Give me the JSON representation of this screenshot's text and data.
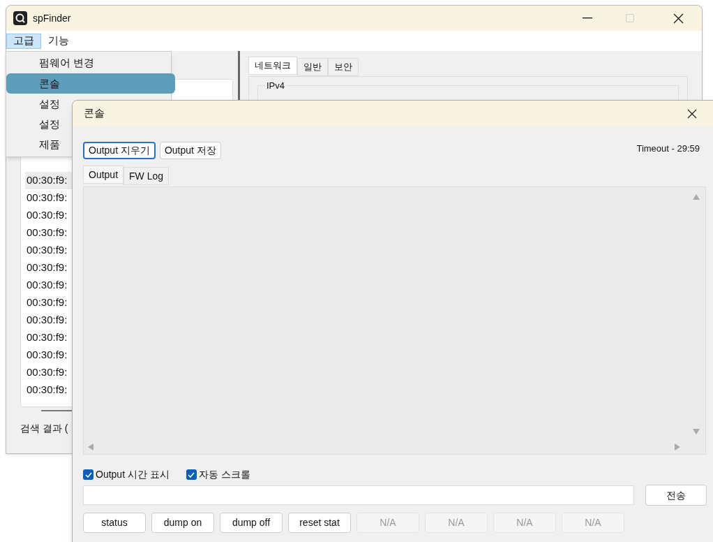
{
  "main_window": {
    "title": "spFinder",
    "menu_bar": [
      {
        "label": "고급",
        "selected": true
      },
      {
        "label": "기능",
        "selected": false
      }
    ],
    "tabs": [
      {
        "label": "네트워크",
        "selected": true
      },
      {
        "label": "일반",
        "selected": false
      },
      {
        "label": "보안",
        "selected": false
      }
    ],
    "group_title": "IPv4",
    "device_list": [
      {
        "label": "00:30:f9:",
        "selected": true
      },
      {
        "label": "00:30:f9:",
        "selected": false
      },
      {
        "label": "00:30:f9:",
        "selected": false
      },
      {
        "label": "00:30:f9:",
        "selected": false
      },
      {
        "label": "00:30:f9:",
        "selected": false
      },
      {
        "label": "00:30:f9:",
        "selected": false
      },
      {
        "label": "00:30:f9:",
        "selected": false
      },
      {
        "label": "00:30:f9:",
        "selected": false
      },
      {
        "label": "00:30:f9:",
        "selected": false
      },
      {
        "label": "00:30:f9:",
        "selected": false
      },
      {
        "label": "00:30:f9:",
        "selected": false
      },
      {
        "label": "00:30:f9:",
        "selected": false
      },
      {
        "label": "00:30:f9:",
        "selected": false
      }
    ],
    "status_text": "검색 결과 ("
  },
  "menu_dropdown": [
    {
      "label": "펌웨어 변경",
      "selected": false
    },
    {
      "label": "콘솔",
      "selected": true
    },
    {
      "label": "설정",
      "selected": false
    },
    {
      "label": "설정",
      "selected": false
    },
    {
      "label": "제품",
      "selected": false
    }
  ],
  "console": {
    "title": "콘솔",
    "buttons": [
      {
        "label": "Output 지우기",
        "focused": true
      },
      {
        "label": "Output 저장",
        "focused": false
      }
    ],
    "timeout": "Timeout - 29:59",
    "tabs": [
      {
        "label": "Output",
        "selected": true
      },
      {
        "label": "FW Log",
        "selected": false
      }
    ],
    "checkboxes": [
      {
        "label": "Output 시간 표시",
        "checked": true
      },
      {
        "label": "자동 스크롤",
        "checked": true
      }
    ],
    "send_button": "전송",
    "command_buttons": [
      {
        "label": "status",
        "disabled": false
      },
      {
        "label": "dump on",
        "disabled": false
      },
      {
        "label": "dump off",
        "disabled": false
      },
      {
        "label": "reset stat",
        "disabled": false
      },
      {
        "label": "N/A",
        "disabled": true
      },
      {
        "label": "N/A",
        "disabled": true
      },
      {
        "label": "N/A",
        "disabled": true
      },
      {
        "label": "N/A",
        "disabled": true
      }
    ]
  }
}
